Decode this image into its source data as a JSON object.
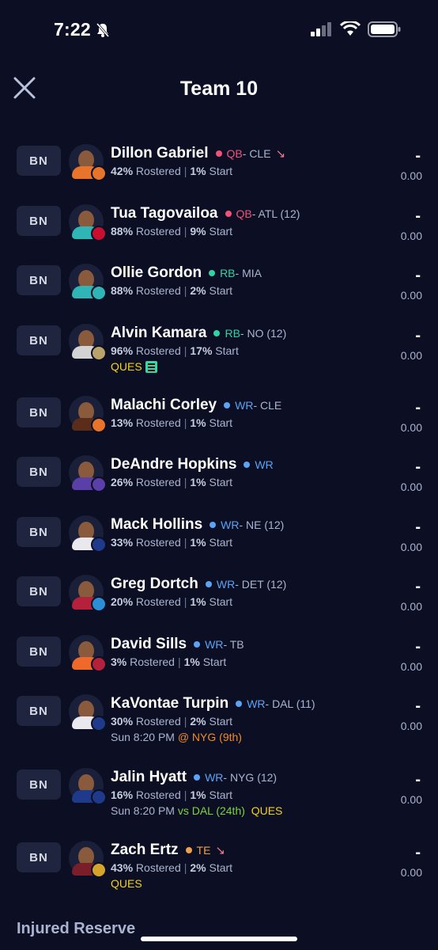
{
  "status": {
    "time": "7:22"
  },
  "header": {
    "title": "Team 10"
  },
  "section_title": "Injured Reserve",
  "players": [
    {
      "slot": "BN",
      "name": "Dillon Gabriel",
      "pos": "QB",
      "team_text": " - CLE",
      "trend": "↘",
      "rostered": "42%",
      "rostered_label": "Rostered",
      "start": "1%",
      "start_label": "Start",
      "dash": "-",
      "points": "0.00",
      "colors": {
        "pos": "#f0527a",
        "jersey": "#e8742c",
        "logo": "#e8742c"
      }
    },
    {
      "slot": "BN",
      "name": "Tua Tagovailoa",
      "pos": "QB",
      "team_text": " - ATL (12)",
      "rostered": "88%",
      "rostered_label": "Rostered",
      "start": "9%",
      "start_label": "Start",
      "dash": "-",
      "points": "0.00",
      "colors": {
        "pos": "#f0527a",
        "jersey": "#2fb5b5",
        "logo": "#c8102e"
      }
    },
    {
      "slot": "BN",
      "name": "Ollie Gordon",
      "pos": "RB",
      "team_text": " - MIA",
      "rostered": "88%",
      "rostered_label": "Rostered",
      "start": "2%",
      "start_label": "Start",
      "dash": "-",
      "points": "0.00",
      "colors": {
        "pos": "#2fd4a3",
        "jersey": "#2fb5b5",
        "logo": "#2fb5b5"
      }
    },
    {
      "slot": "BN",
      "name": "Alvin Kamara",
      "pos": "RB",
      "team_text": " - NO (12)",
      "rostered": "96%",
      "rostered_label": "Rostered",
      "start": "17%",
      "start_label": "Start",
      "injury": "QUES",
      "dash": "-",
      "points": "0.00",
      "colors": {
        "pos": "#2fd4a3",
        "jersey": "#d3d3d3",
        "logo": "#b9a36a"
      }
    },
    {
      "slot": "BN",
      "name": "Malachi Corley",
      "pos": "WR",
      "team_text": " - CLE",
      "rostered": "13%",
      "rostered_label": "Rostered",
      "start": "1%",
      "start_label": "Start",
      "dash": "-",
      "points": "0.00",
      "colors": {
        "pos": "#5aa3f5",
        "jersey": "#5a2d1a",
        "logo": "#e8742c"
      }
    },
    {
      "slot": "BN",
      "name": "DeAndre Hopkins",
      "pos": "WR",
      "team_text": "",
      "rostered": "26%",
      "rostered_label": "Rostered",
      "start": "1%",
      "start_label": "Start",
      "dash": "-",
      "points": "0.00",
      "colors": {
        "pos": "#5aa3f5",
        "jersey": "#5b3fa8",
        "logo": "#5b3fa8"
      }
    },
    {
      "slot": "BN",
      "name": "Mack Hollins",
      "pos": "WR",
      "team_text": " - NE (12)",
      "rostered": "33%",
      "rostered_label": "Rostered",
      "start": "1%",
      "start_label": "Start",
      "dash": "-",
      "points": "0.00",
      "colors": {
        "pos": "#5aa3f5",
        "jersey": "#e8e8ee",
        "logo": "#1f3a8a"
      }
    },
    {
      "slot": "BN",
      "name": "Greg Dortch",
      "pos": "WR",
      "team_text": " - DET (12)",
      "rostered": "20%",
      "rostered_label": "Rostered",
      "start": "1%",
      "start_label": "Start",
      "dash": "-",
      "points": "0.00",
      "colors": {
        "pos": "#5aa3f5",
        "jersey": "#b5203a",
        "logo": "#2b8fd6"
      }
    },
    {
      "slot": "BN",
      "name": "David Sills",
      "pos": "WR",
      "team_text": " - TB",
      "rostered": "3%",
      "rostered_label": "Rostered",
      "start": "1%",
      "start_label": "Start",
      "dash": "-",
      "points": "0.00",
      "colors": {
        "pos": "#5aa3f5",
        "jersey": "#ef6a2a",
        "logo": "#b5203a"
      }
    },
    {
      "slot": "BN",
      "name": "KaVontae Turpin",
      "pos": "WR",
      "team_text": " - DAL (11)",
      "rostered": "30%",
      "rostered_label": "Rostered",
      "start": "2%",
      "start_label": "Start",
      "game_time": "Sun 8:20 PM",
      "matchup": "@ NYG (9th)",
      "dash": "-",
      "points": "0.00",
      "colors": {
        "pos": "#5aa3f5",
        "jersey": "#e8e8ee",
        "logo": "#1f3a8a",
        "matchup": "#f08a2a"
      }
    },
    {
      "slot": "BN",
      "name": "Jalin Hyatt",
      "pos": "WR",
      "team_text": " - NYG (12)",
      "rostered": "16%",
      "rostered_label": "Rostered",
      "start": "1%",
      "start_label": "Start",
      "game_time": "Sun 8:20 PM",
      "matchup": "vs DAL (24th)",
      "injury": "QUES",
      "dash": "-",
      "points": "0.00",
      "colors": {
        "pos": "#5aa3f5",
        "jersey": "#1f3a8a",
        "logo": "#1f3a8a",
        "matchup": "#7ad63a"
      }
    },
    {
      "slot": "BN",
      "name": "Zach Ertz",
      "pos": "TE",
      "team_text": "",
      "trend": "↘",
      "rostered": "43%",
      "rostered_label": "Rostered",
      "start": "2%",
      "start_label": "Start",
      "injury": "QUES",
      "dash": "-",
      "points": "0.00",
      "colors": {
        "pos": "#f0a04a",
        "jersey": "#7a1f2a",
        "logo": "#d4a52a"
      }
    }
  ]
}
